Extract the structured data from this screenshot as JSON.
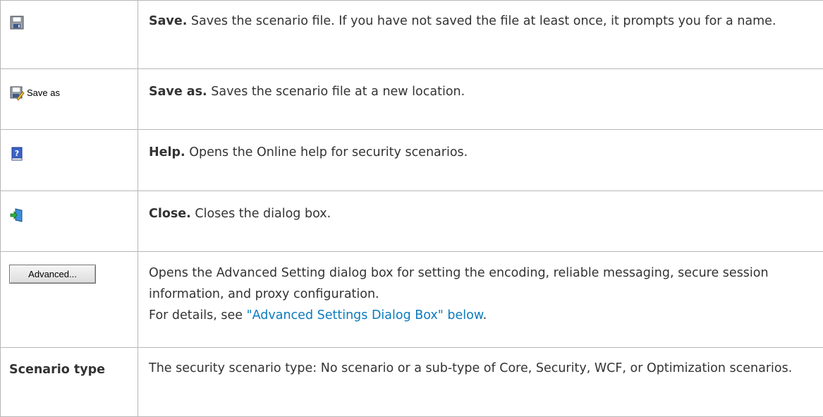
{
  "rows": [
    {
      "ui": {
        "icon": "floppy-save-icon"
      },
      "term": "Save.",
      "desc": "Saves the scenario file. If you have not saved the file at least once, it prompts you for a name."
    },
    {
      "ui": {
        "icon": "save-as-icon",
        "label": "Save as"
      },
      "term": "Save as.",
      "desc": "Saves the scenario file at a new location."
    },
    {
      "ui": {
        "icon": "help-book-icon"
      },
      "term": "Help.",
      "desc": "Opens the Online help for security scenarios."
    },
    {
      "ui": {
        "icon": "close-exit-icon"
      },
      "term": "Close.",
      "desc": "Closes the dialog box."
    },
    {
      "ui": {
        "button_label": "Advanced..."
      },
      "desc": "Opens the Advanced Setting dialog box for setting the encoding, reliable messaging, secure session information, and proxy configuration.",
      "details_prefix": "For details, see ",
      "details_link": "\"Advanced Settings Dialog Box\" below",
      "details_suffix": "."
    },
    {
      "ui": {
        "label": "Scenario type"
      },
      "desc": "The security scenario type: No scenario or a sub-type of Core, Security, WCF, or Optimization scenarios."
    }
  ],
  "colors": {
    "link": "#0a7bbd",
    "text": "#333333",
    "border": "#b7b7b7"
  }
}
